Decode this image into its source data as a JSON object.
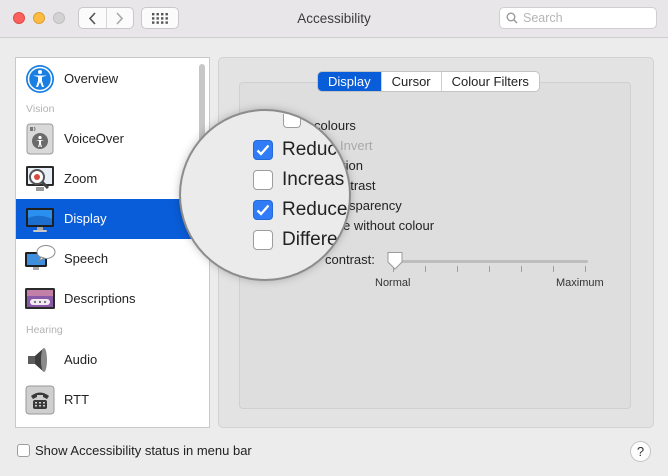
{
  "window": {
    "title": "Accessibility"
  },
  "search": {
    "placeholder": "Search"
  },
  "sidebar": {
    "headings": {
      "vision": "Vision",
      "hearing": "Hearing"
    },
    "items": [
      {
        "label": "Overview",
        "icon": "accessibility-person-icon"
      },
      {
        "label": "VoiceOver",
        "icon": "voiceover-icon"
      },
      {
        "label": "Zoom",
        "icon": "zoom-magnifier-icon"
      },
      {
        "label": "Display",
        "icon": "display-monitor-icon",
        "selected": true
      },
      {
        "label": "Speech",
        "icon": "speech-bubble-icon"
      },
      {
        "label": "Descriptions",
        "icon": "descriptions-icon"
      },
      {
        "label": "Audio",
        "icon": "speaker-icon"
      },
      {
        "label": "RTT",
        "icon": "telephone-icon"
      }
    ]
  },
  "tabs": [
    {
      "label": "Display",
      "active": true
    },
    {
      "label": "Cursor",
      "active": false
    },
    {
      "label": "Colour Filters",
      "active": false
    }
  ],
  "options": {
    "partial_colours": "colours",
    "partial_invert": "Invert",
    "partial_motion": "tion",
    "partial_contrast": "ntrast",
    "partial_transparency": "sparency",
    "partial_without_colour": "e without colour",
    "contrast_label": "contrast:"
  },
  "slider": {
    "min_label": "Normal",
    "max_label": "Maximum",
    "value_fraction": 0.0,
    "ticks": 7
  },
  "magnifier": {
    "rows": [
      {
        "label": "Reduce",
        "checked": true
      },
      {
        "label": "Increas",
        "checked": false
      },
      {
        "label": "Reduce",
        "checked": true
      },
      {
        "label": "Differe",
        "checked": false
      }
    ]
  },
  "footer": {
    "status_checkbox_label": "Show Accessibility status in menu bar",
    "status_checked": false,
    "help_label": "?"
  },
  "colors": {
    "accent": "#0a5dd8",
    "checkbox_on": "#2f7cf6"
  }
}
